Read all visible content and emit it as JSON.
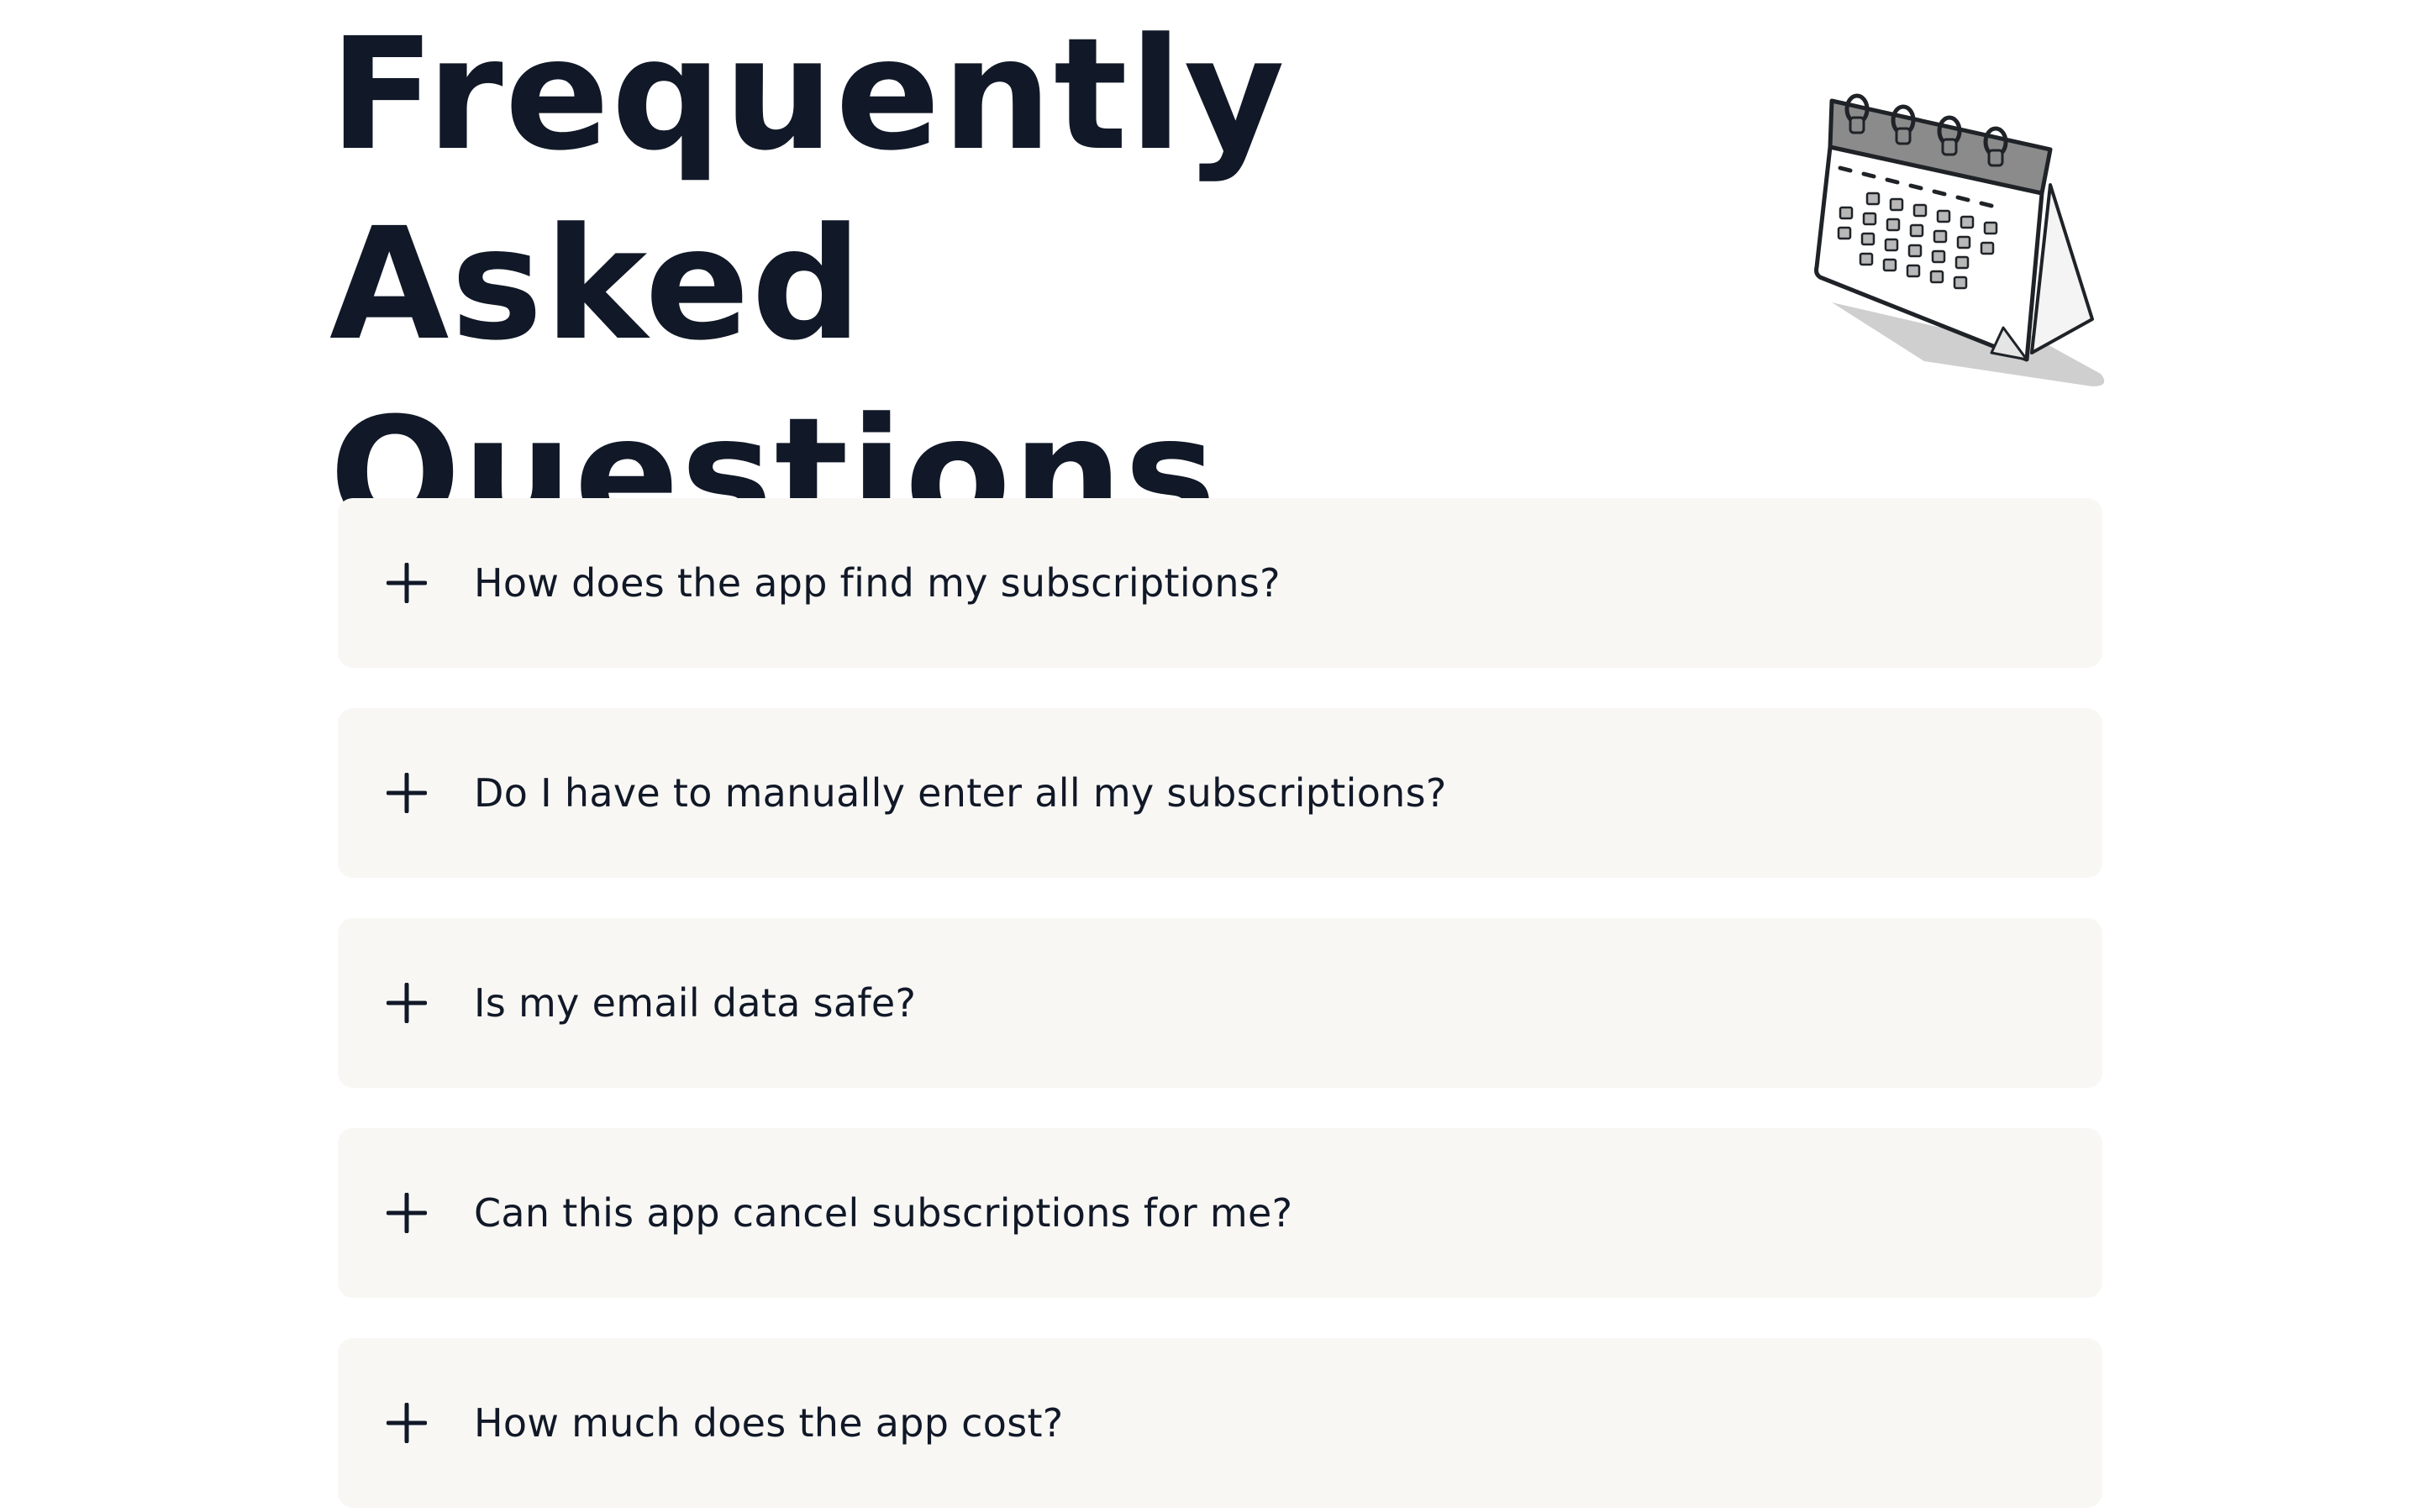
{
  "header": {
    "title": "Frequently Asked Questions",
    "illustration_icon": "desk-calendar-icon"
  },
  "faq": {
    "expand_icon": "plus-icon",
    "item_background": "#f8f7f4",
    "text_color": "#111827",
    "items": [
      {
        "question": "How does the app find my subscriptions?"
      },
      {
        "question": "Do I have to manually enter all my subscriptions?"
      },
      {
        "question": "Is my email data safe?"
      },
      {
        "question": "Can this app cancel subscriptions for me?"
      },
      {
        "question": "How much does the app cost?"
      }
    ]
  }
}
